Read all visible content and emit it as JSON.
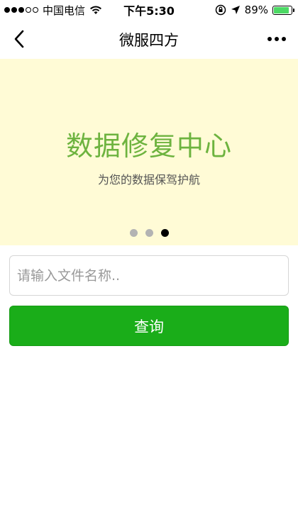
{
  "status_bar": {
    "carrier": "中国电信",
    "time": "下午5:30",
    "battery_percent": "89%",
    "battery_level": 0.89,
    "signal_bars_on": 3,
    "signal_bars_total": 5,
    "icons": [
      "signal-dots-icon",
      "wifi-icon",
      "rotation-lock-icon",
      "location-arrow-icon",
      "battery-icon"
    ]
  },
  "nav": {
    "title": "微服四方",
    "back_icon": "chevron-left-icon",
    "more_icon": "more-dots-icon"
  },
  "banner": {
    "title": "数据修复中心",
    "subtitle": "为您的数据保驾护航",
    "background_color": "#fffbd6",
    "title_color": "#6db33f",
    "page_count": 3,
    "active_page": 3
  },
  "search": {
    "placeholder": "请输入文件名称..",
    "value": ""
  },
  "query_button": {
    "label": "查询",
    "color": "#1aad19"
  }
}
